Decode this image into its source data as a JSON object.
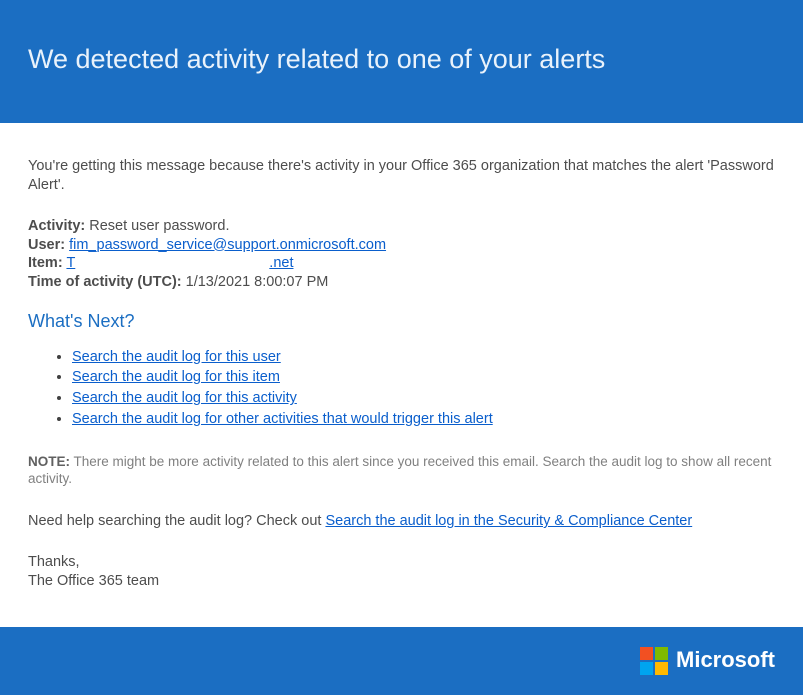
{
  "header": {
    "title": "We detected activity related to one of your alerts"
  },
  "intro": "You're getting this message because there's activity in your Office 365 organization that matches the alert 'Password Alert'.",
  "details": {
    "activity_label": "Activity:",
    "activity_value": "Reset user password.",
    "user_label": "User:",
    "user_value": "fim_password_service@support.onmicrosoft.com",
    "item_label": "Item:",
    "item_prefix": "T",
    "item_suffix": ".net",
    "time_label": "Time of activity (UTC):",
    "time_value": "1/13/2021 8:00:07 PM"
  },
  "next_heading": "What's Next?",
  "actions": [
    "Search the audit log for this user",
    "Search the audit log for this item",
    "Search the audit log for this activity",
    "Search the audit log for other activities that would trigger this alert"
  ],
  "note": {
    "label": "NOTE:",
    "text": "There might be more activity related to this alert since you received this email. Search the audit log to show all recent activity."
  },
  "help": {
    "text": "Need help searching the audit log? Check out ",
    "link": "Search the audit log in the Security & Compliance Center"
  },
  "signoff": {
    "thanks": "Thanks,",
    "team": "The Office 365 team"
  },
  "footer": {
    "brand": "Microsoft"
  }
}
